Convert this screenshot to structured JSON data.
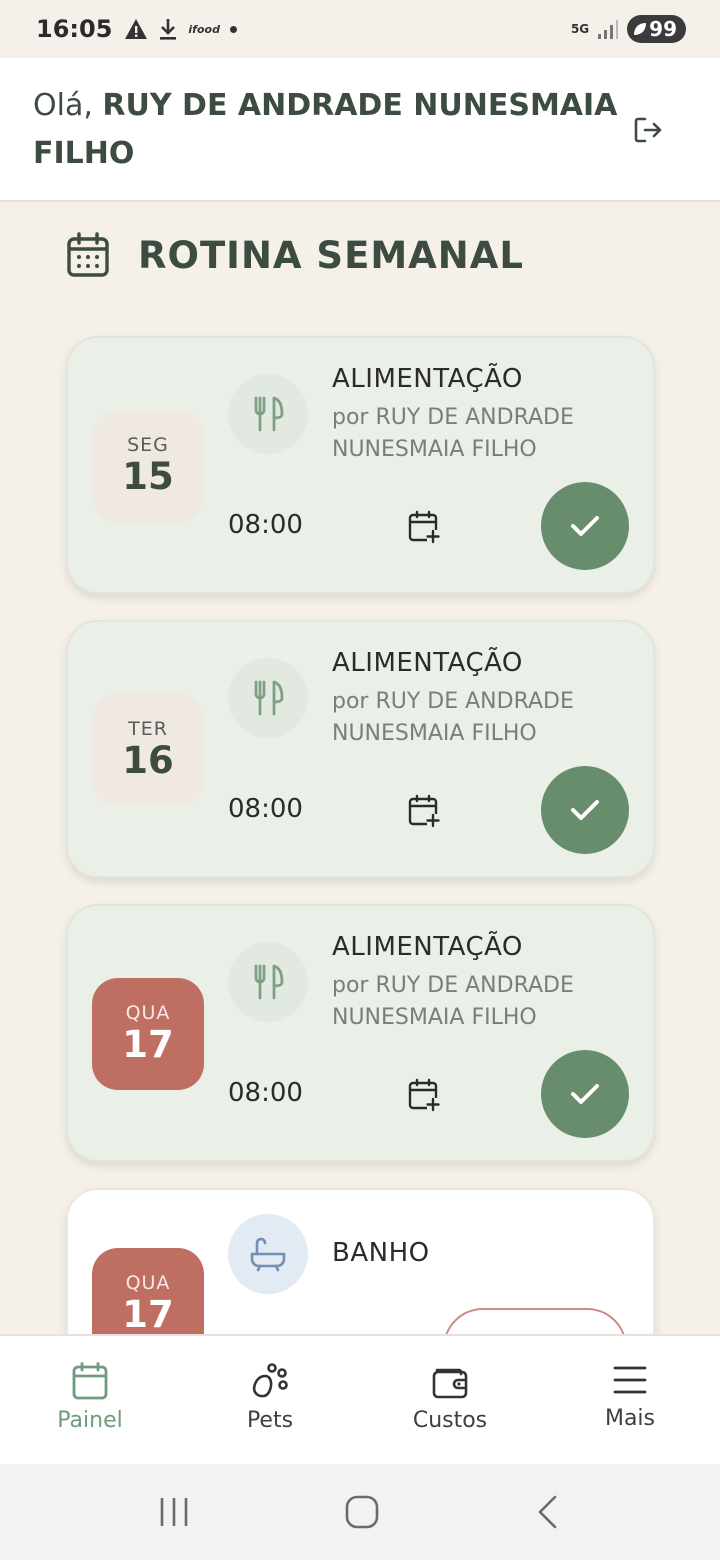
{
  "status_bar": {
    "time": "16:05",
    "ifood_label": "ifood",
    "network_label": "5G",
    "battery": "99"
  },
  "header": {
    "greeting_prefix": "Olá,",
    "user_name": "RUY DE ANDRADE NUNESMAIA FILHO"
  },
  "section": {
    "title": "ROTINA SEMANAL"
  },
  "cards": [
    {
      "dow": "SEG",
      "dom": "15",
      "today": false,
      "title": "ALIMENTAÇÃO",
      "by": "por RUY DE ANDRADE NUNESMAIA FILHO",
      "time": "08:00",
      "icon": "fork-knife-icon",
      "done": true
    },
    {
      "dow": "TER",
      "dom": "16",
      "today": false,
      "title": "ALIMENTAÇÃO",
      "by": "por RUY DE ANDRADE NUNESMAIA FILHO",
      "time": "08:00",
      "icon": "fork-knife-icon",
      "done": true
    },
    {
      "dow": "QUA",
      "dom": "17",
      "today": true,
      "title": "ALIMENTAÇÃO",
      "by": "por RUY DE ANDRADE NUNESMAIA FILHO",
      "time": "08:00",
      "icon": "fork-knife-icon",
      "done": true
    },
    {
      "dow": "QUA",
      "dom": "17",
      "today": true,
      "title": "BANHO",
      "icon": "bathtub-icon",
      "done": false
    }
  ],
  "nav": [
    {
      "label": "Painel",
      "icon": "calendar-icon",
      "active": true
    },
    {
      "label": "Pets",
      "icon": "paw-icon",
      "active": false
    },
    {
      "label": "Custos",
      "icon": "wallet-icon",
      "active": false
    },
    {
      "label": "Mais",
      "icon": "menu-icon",
      "active": false
    }
  ],
  "colors": {
    "accent_green": "#678d6c",
    "today_red": "#bf6e62",
    "background": "#f5f0e9",
    "nav_active": "#6f9c7d"
  }
}
